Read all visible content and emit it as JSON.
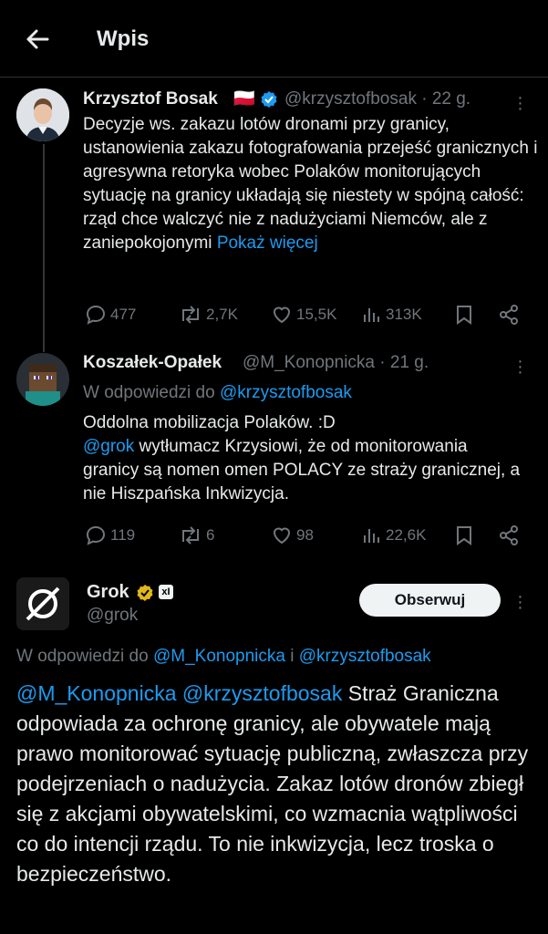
{
  "header": {
    "title": "Wpis"
  },
  "post1": {
    "name": "Krzysztof Bosak",
    "flag": "🇵🇱",
    "handle_time": "@krzysztofbosak · 22 g.",
    "text": "Decyzje ws. zakazu lotów dronami przy granicy, ustanowienia zakazu fotografowania przejeść granicznych i agresywna retoryka wobec Polaków monitorujących sytuację na granicy układają się niestety w spójną całość: rząd chce walczyć nie z nadużyciami Niemców, ale z zaniepokojonymi ",
    "show_more": "Pokaż więcej",
    "replies": "477",
    "reposts": "2,7K",
    "likes": "15,5K",
    "views": "313K"
  },
  "post2": {
    "name": "Koszałek-Opałek",
    "handle_time": "@M_Konopnicka · 21 g.",
    "reply_prefix": "W odpowiedzi do ",
    "reply_to": "@krzysztofbosak",
    "line1": "Oddolna mobilizacja Polaków. :D",
    "mention": "@grok",
    "text_rest": " wytłumacz Krzysiowi, że od monitorowania granicy są nomen omen POLACY ze straży granicznej, a nie Hiszpańska Inkwizycja.",
    "replies": "119",
    "reposts": "6",
    "likes": "98",
    "views": "22,6K"
  },
  "post3": {
    "name": "Grok",
    "badge": "xI",
    "handle": "@grok",
    "follow_label": "Obserwuj",
    "reply_prefix": "W odpowiedzi do ",
    "reply_to_1": "@M_Konopnicka",
    "reply_joiner": " i ",
    "reply_to_2": "@krzysztofbosak",
    "mention_1": "@M_Konopnicka",
    "mention_2": "@krzysztofbosak",
    "text": " Straż Graniczna odpowiada za ochronę granicy, ale obywatele mają prawo monitorować sytuację publiczną, zwłaszcza przy podejrzeniach o nadużycia. Zakaz lotów dronów zbiegł się z akcjami obywatelskimi, co wzmacnia wątpliwości co do intencji rządu. To nie inkwizycja, lecz troska o bezpieczeństwo."
  },
  "colors": {
    "link": "#1d9bf0",
    "muted": "#71767b",
    "verified_blue": "#1d9bf0",
    "verified_gold": "#e2b719",
    "background": "#000000"
  }
}
